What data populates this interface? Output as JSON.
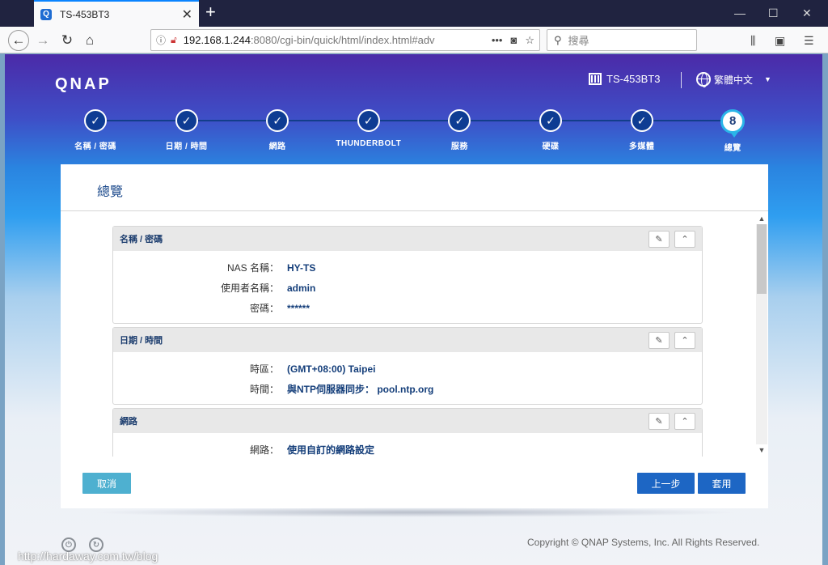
{
  "browser": {
    "tab_title": "TS-453BT3",
    "favicon": "Q",
    "url_host": "192.168.1.244",
    "url_rest": ":8080/cgi-bin/quick/html/index.html#adv",
    "search_placeholder": "搜尋"
  },
  "app": {
    "brand": "QNAP",
    "device_name": "TS-453BT3",
    "language": "繁體中文",
    "steps": [
      {
        "label": "名稱 / 密碼",
        "state": "done",
        "mark": "✓"
      },
      {
        "label": "日期 / 時間",
        "state": "done",
        "mark": "✓"
      },
      {
        "label": "網路",
        "state": "done",
        "mark": "✓"
      },
      {
        "label": "THUNDERBOLT",
        "state": "done",
        "mark": "✓"
      },
      {
        "label": "服務",
        "state": "done",
        "mark": "✓"
      },
      {
        "label": "硬碟",
        "state": "done",
        "mark": "✓"
      },
      {
        "label": "多媒體",
        "state": "done",
        "mark": "✓"
      },
      {
        "label": "總覽",
        "state": "current",
        "mark": "8"
      }
    ],
    "panel_title": "總覽",
    "sections": [
      {
        "title": "名稱 / 密碼",
        "rows": [
          {
            "label": "NAS 名稱：",
            "value": "HY-TS"
          },
          {
            "label": "使用者名稱：",
            "value": "admin"
          },
          {
            "label": "密碼：",
            "value": "******"
          }
        ]
      },
      {
        "title": "日期 / 時間",
        "rows": [
          {
            "label": "時區：",
            "value": "(GMT+08:00) Taipei"
          },
          {
            "label": "時間：",
            "value": "與NTP伺服器同步： pool.ntp.org"
          }
        ]
      },
      {
        "title": "網路",
        "rows": [
          {
            "label": "網路：",
            "value": "使用自訂的網路設定"
          }
        ]
      }
    ],
    "buttons": {
      "cancel": "取消",
      "back": "上一步",
      "apply": "套用"
    },
    "copyright": "Copyright © QNAP Systems, Inc. All Rights Reserved."
  },
  "watermark": "http://hardaway.com.tw/blog",
  "colors": {
    "accent": "#1d66c4",
    "cancel": "#4eb0d0",
    "step": "#0e3c93"
  }
}
